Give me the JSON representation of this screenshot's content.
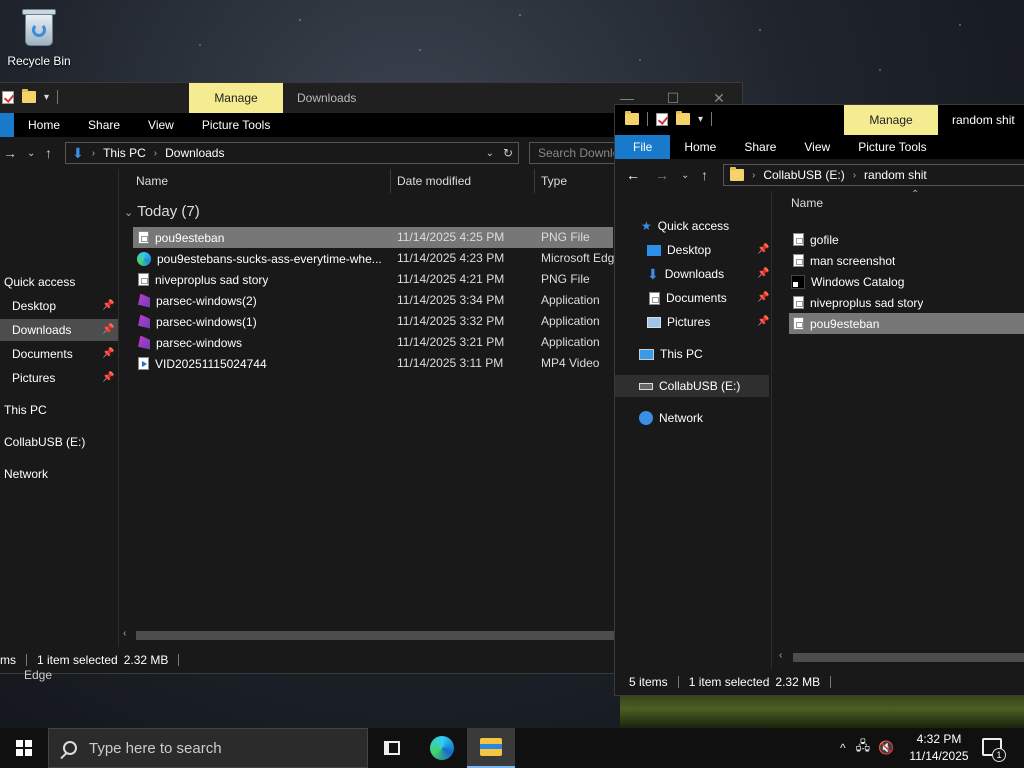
{
  "desktop": {
    "recycle_bin_label": "Recycle Bin",
    "behind_text": "Edge"
  },
  "left_window": {
    "manage_label": "Manage",
    "title": "Downloads",
    "ribbon_tabs": [
      "Home",
      "Share",
      "View",
      "Picture Tools"
    ],
    "breadcrumb": [
      "This PC",
      "Downloads"
    ],
    "search_placeholder": "Search Downlo",
    "columns": [
      "Name",
      "Date modified",
      "Type"
    ],
    "group_label": "Today (7)",
    "nav": [
      {
        "label": "Quick access"
      },
      {
        "label": "Desktop",
        "pinned": true
      },
      {
        "label": "Downloads",
        "pinned": true
      },
      {
        "label": "Documents",
        "pinned": true
      },
      {
        "label": "Pictures",
        "pinned": true
      },
      {
        "label": "This PC"
      },
      {
        "label": "CollabUSB (E:)"
      },
      {
        "label": "Network"
      }
    ],
    "files": [
      {
        "name": "pou9esteban",
        "date": "11/14/2025 4:25 PM",
        "type": "PNG File",
        "icon": "png-file-icon"
      },
      {
        "name": "pou9estebans-sucks-ass-everytime-whe...",
        "date": "11/14/2025 4:23 PM",
        "type": "Microsoft Edg",
        "icon": "edge-file-icon"
      },
      {
        "name": "niveproplus sad story",
        "date": "11/14/2025 4:21 PM",
        "type": "PNG File",
        "icon": "png-file-icon"
      },
      {
        "name": "parsec-windows(2)",
        "date": "11/14/2025 3:34 PM",
        "type": "Application",
        "icon": "app-icon"
      },
      {
        "name": "parsec-windows(1)",
        "date": "11/14/2025 3:32 PM",
        "type": "Application",
        "icon": "app-icon"
      },
      {
        "name": "parsec-windows",
        "date": "11/14/2025 3:21 PM",
        "type": "Application",
        "icon": "app-icon"
      },
      {
        "name": "VID20251115024744",
        "date": "11/14/2025 3:11 PM",
        "type": "MP4 Video",
        "icon": "mp4-file-icon"
      }
    ],
    "status_items_fragment": "ms",
    "status_selected": "1 item selected",
    "status_size": "2.32 MB"
  },
  "right_window": {
    "manage_label": "Manage",
    "title": "random shit",
    "ribbon_tabs": [
      "File",
      "Home",
      "Share",
      "View",
      "Picture Tools"
    ],
    "breadcrumb": [
      "CollabUSB (E:)",
      "random shit"
    ],
    "column_name": "Name",
    "nav": [
      {
        "label": "Quick access"
      },
      {
        "label": "Desktop",
        "pinned": true
      },
      {
        "label": "Downloads",
        "pinned": true
      },
      {
        "label": "Documents",
        "pinned": true
      },
      {
        "label": "Pictures",
        "pinned": true
      },
      {
        "label": "This PC"
      },
      {
        "label": "CollabUSB (E:)"
      },
      {
        "label": "Network"
      }
    ],
    "files": [
      {
        "name": "gofile",
        "icon": "png-file-icon"
      },
      {
        "name": "man screenshot",
        "icon": "png-file-icon"
      },
      {
        "name": "Windows Catalog",
        "icon": "catalog-icon"
      },
      {
        "name": "niveproplus sad story",
        "icon": "png-file-icon"
      },
      {
        "name": "pou9esteban",
        "icon": "png-file-icon"
      }
    ],
    "status_items": "5 items",
    "status_selected": "1 item selected",
    "status_size": "2.32 MB"
  },
  "taskbar": {
    "search_placeholder": "Type here to search",
    "time": "4:32 PM",
    "date": "11/14/2025",
    "notification_count": "1"
  },
  "colors": {
    "accent": "#1979ca",
    "manage_tab": "#f5ec91",
    "selection": "#777777"
  }
}
